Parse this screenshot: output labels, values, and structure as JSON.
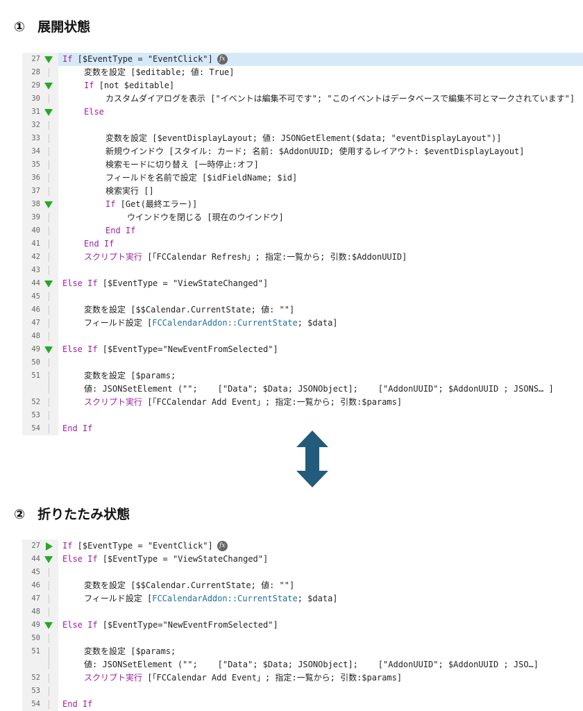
{
  "section1": {
    "number": "①",
    "title": "展開状態"
  },
  "section2": {
    "number": "②",
    "title": "折りたたみ状態"
  },
  "colors": {
    "keyword": "#a020a0",
    "field": "#1f6fa0",
    "highlight": "#d6e9f8",
    "triangle": "#22aa22",
    "arrow": "#235b7d"
  },
  "icons": {
    "fx": "fx-icon",
    "expanded": "triangle-down-icon",
    "collapsed": "triangle-right-icon",
    "arrow": "double-arrow-icon"
  },
  "panel1": [
    {
      "ln": "27",
      "fold": "down",
      "indent": 0,
      "hl": true,
      "fx": true,
      "segs": [
        [
          "kw",
          "If"
        ],
        [
          "",
          " [$EventType = \"EventClick\"]"
        ]
      ]
    },
    {
      "ln": "28",
      "fold": "",
      "indent": 1,
      "segs": [
        [
          "",
          "変数を設定 [$editable; 値: True]"
        ]
      ]
    },
    {
      "ln": "29",
      "fold": "down",
      "indent": 1,
      "segs": [
        [
          "kw",
          "If"
        ],
        [
          "",
          " [not $editable]"
        ]
      ]
    },
    {
      "ln": "30",
      "fold": "",
      "indent": 2,
      "segs": [
        [
          "",
          "カスタムダイアログを表示 [\"イベントは編集不可です\"; \"このイベントはデータベースで編集不可とマークされています\"]"
        ]
      ]
    },
    {
      "ln": "31",
      "fold": "down",
      "indent": 1,
      "segs": [
        [
          "kw",
          "Else"
        ]
      ]
    },
    {
      "ln": "32",
      "fold": "",
      "indent": 0,
      "segs": []
    },
    {
      "ln": "33",
      "fold": "",
      "indent": 2,
      "segs": [
        [
          "",
          "変数を設定 [$eventDisplayLayout; 値: JSONGetElement($data; \"eventDisplayLayout\")]"
        ]
      ]
    },
    {
      "ln": "34",
      "fold": "",
      "indent": 2,
      "segs": [
        [
          "",
          "新規ウインドウ [スタイル: カード; 名前: $AddonUUID; 使用するレイアウト: $eventDisplayLayout]"
        ]
      ]
    },
    {
      "ln": "35",
      "fold": "",
      "indent": 2,
      "segs": [
        [
          "",
          "検索モードに切り替え [一時停止:オフ]"
        ]
      ]
    },
    {
      "ln": "36",
      "fold": "",
      "indent": 2,
      "segs": [
        [
          "",
          "フィールドを名前で設定 [$idFieldName; $id]"
        ]
      ]
    },
    {
      "ln": "37",
      "fold": "",
      "indent": 2,
      "segs": [
        [
          "",
          "検索実行 []"
        ]
      ]
    },
    {
      "ln": "38",
      "fold": "down",
      "indent": 2,
      "segs": [
        [
          "kw",
          "If"
        ],
        [
          "",
          " [Get(最終エラー)]"
        ]
      ]
    },
    {
      "ln": "39",
      "fold": "",
      "indent": 3,
      "segs": [
        [
          "",
          "ウインドウを閉じる [現在のウインドウ]"
        ]
      ]
    },
    {
      "ln": "40",
      "fold": "",
      "indent": 2,
      "segs": [
        [
          "kw",
          "End If"
        ]
      ]
    },
    {
      "ln": "41",
      "fold": "",
      "indent": 1,
      "segs": [
        [
          "kw",
          "End If"
        ]
      ]
    },
    {
      "ln": "42",
      "fold": "",
      "indent": 1,
      "segs": [
        [
          "kw",
          "スクリプト実行"
        ],
        [
          "",
          " [「FCCalendar Refresh」; 指定:一覧から; 引数:$AddonUUID]"
        ]
      ]
    },
    {
      "ln": "43",
      "fold": "",
      "indent": 0,
      "segs": []
    },
    {
      "ln": "44",
      "fold": "down",
      "indent": 0,
      "segs": [
        [
          "kw",
          "Else If"
        ],
        [
          "",
          " [$EventType = \"ViewStateChanged\"]"
        ]
      ]
    },
    {
      "ln": "45",
      "fold": "",
      "indent": 0,
      "segs": []
    },
    {
      "ln": "46",
      "fold": "",
      "indent": 1,
      "segs": [
        [
          "",
          "変数を設定 [$$Calendar.CurrentState; 値: \"\"]"
        ]
      ]
    },
    {
      "ln": "47",
      "fold": "",
      "indent": 1,
      "segs": [
        [
          "",
          "フィールド設定 ["
        ],
        [
          "fld",
          "FCCalendarAddon::CurrentState"
        ],
        [
          "",
          "; $data]"
        ]
      ]
    },
    {
      "ln": "48",
      "fold": "",
      "indent": 0,
      "segs": []
    },
    {
      "ln": "49",
      "fold": "down",
      "indent": 0,
      "segs": [
        [
          "kw",
          "Else If"
        ],
        [
          "",
          " [$EventType=\"NewEventFromSelected\"]"
        ]
      ]
    },
    {
      "ln": "50",
      "fold": "",
      "indent": 0,
      "segs": []
    },
    {
      "ln": "51",
      "fold": "",
      "indent": 1,
      "tall": true,
      "segs": [
        [
          "",
          "変数を設定 [$params;"
        ]
      ],
      "segs2": [
        [
          "",
          "値: JSONSetElement (\"\";    [\"Data\"; $Data; JSONObject];    [\"AddonUUID\"; $AddonUUID ; JSONS… ]"
        ]
      ]
    },
    {
      "ln": "52",
      "fold": "",
      "indent": 1,
      "segs": [
        [
          "kw",
          "スクリプト実行"
        ],
        [
          "",
          " [「FCCalendar Add Event」; 指定:一覧から; 引数:$params]"
        ]
      ]
    },
    {
      "ln": "53",
      "fold": "",
      "indent": 0,
      "segs": []
    },
    {
      "ln": "54",
      "fold": "",
      "indent": 0,
      "segs": [
        [
          "kw",
          "End If"
        ]
      ]
    }
  ],
  "panel2": [
    {
      "ln": "27",
      "fold": "right",
      "indent": 0,
      "fx": true,
      "segs": [
        [
          "kw",
          "If"
        ],
        [
          "",
          " [$EventType = \"EventClick\"]"
        ]
      ]
    },
    {
      "ln": "44",
      "fold": "down",
      "indent": 0,
      "segs": [
        [
          "kw",
          "Else If"
        ],
        [
          "",
          " [$EventType = \"ViewStateChanged\"]"
        ]
      ]
    },
    {
      "ln": "45",
      "fold": "",
      "indent": 0,
      "segs": []
    },
    {
      "ln": "46",
      "fold": "",
      "indent": 1,
      "segs": [
        [
          "",
          "変数を設定 [$$Calendar.CurrentState; 値: \"\"]"
        ]
      ]
    },
    {
      "ln": "47",
      "fold": "",
      "indent": 1,
      "segs": [
        [
          "",
          "フィールド設定 ["
        ],
        [
          "fld",
          "FCCalendarAddon::CurrentState"
        ],
        [
          "",
          "; $data]"
        ]
      ]
    },
    {
      "ln": "48",
      "fold": "",
      "indent": 0,
      "segs": []
    },
    {
      "ln": "49",
      "fold": "down",
      "indent": 0,
      "segs": [
        [
          "kw",
          "Else If"
        ],
        [
          "",
          " [$EventType=\"NewEventFromSelected\"]"
        ]
      ]
    },
    {
      "ln": "50",
      "fold": "",
      "indent": 0,
      "segs": []
    },
    {
      "ln": "51",
      "fold": "",
      "indent": 1,
      "tall": true,
      "segs": [
        [
          "",
          "変数を設定 [$params;"
        ]
      ],
      "segs2": [
        [
          "",
          "値: JSONSetElement (\"\";    [\"Data\"; $Data; JSONObject];    [\"AddonUUID\"; $AddonUUID ; JSO…]"
        ]
      ]
    },
    {
      "ln": "52",
      "fold": "",
      "indent": 1,
      "segs": [
        [
          "kw",
          "スクリプト実行"
        ],
        [
          "",
          " [「FCCalendar Add Event」; 指定:一覧から; 引数:$params]"
        ]
      ]
    },
    {
      "ln": "53",
      "fold": "",
      "indent": 0,
      "segs": []
    },
    {
      "ln": "54",
      "fold": "",
      "indent": 0,
      "segs": [
        [
          "kw",
          "End If"
        ]
      ]
    }
  ]
}
